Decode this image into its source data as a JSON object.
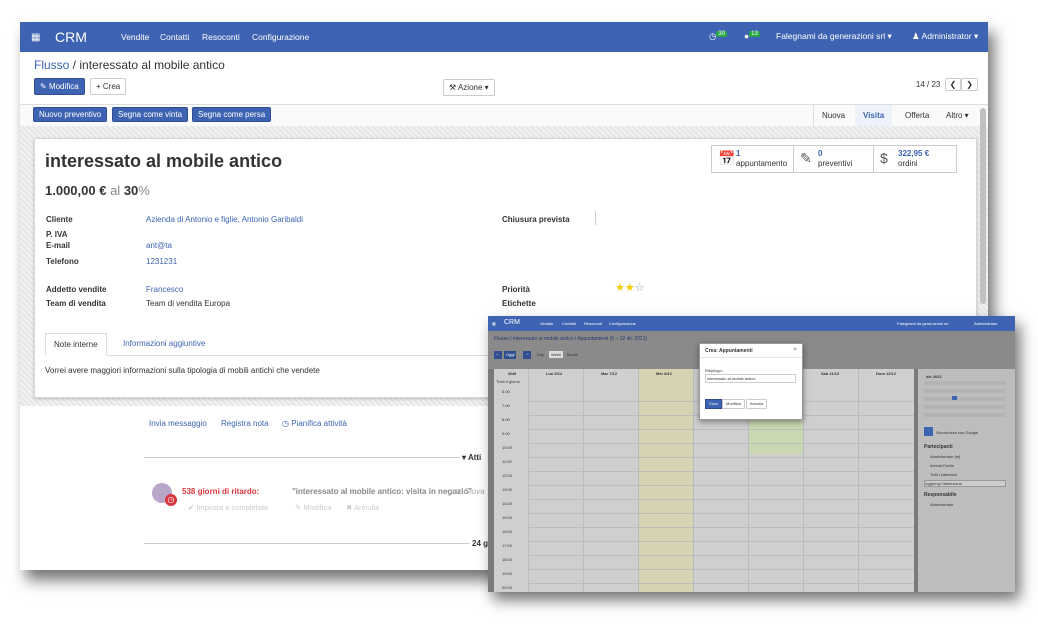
{
  "navbar": {
    "brand": "CRM",
    "menu": [
      "Vendite",
      "Contatti",
      "Resoconti",
      "Configurazione"
    ],
    "activity_count": "30",
    "message_count": "13",
    "company": "Falegnami da generazioni srl",
    "user": "Administrator"
  },
  "breadcrumb": {
    "parent": "Flusso",
    "current": "interessato al mobile antico"
  },
  "toolbar": {
    "edit": "Modifica",
    "create": "Crea",
    "action": "Azione",
    "pager": "14 / 23"
  },
  "statusbar": {
    "buttons": [
      "Nuovo preventivo",
      "Segna come vinta",
      "Segna come persa"
    ],
    "stages": [
      "Nuova",
      "Visita",
      "Offerta",
      "Altro"
    ],
    "active_stage": "Visita"
  },
  "smart_buttons": [
    {
      "icon": "calendar-icon",
      "count": "1",
      "label": "appuntamento"
    },
    {
      "icon": "edit-icon",
      "count": "0",
      "label": "preventivi"
    },
    {
      "icon": "dollar-icon",
      "count": "322,95 €",
      "label": "ordini"
    }
  ],
  "form": {
    "title": "interessato al mobile antico",
    "revenue": "1.000,00 €",
    "at": "al",
    "probability": "30",
    "percent": "%",
    "fields": {
      "cliente": {
        "label": "Cliente",
        "value": "Azienda di Antonio e figlie, Antonio Garibaldi"
      },
      "piva": {
        "label": "P. IVA",
        "value": ""
      },
      "email": {
        "label": "E-mail",
        "value": "ant@ta"
      },
      "telefono": {
        "label": "Telefono",
        "value": "1231231"
      },
      "addetto": {
        "label": "Addetto vendite",
        "value": "Francesco"
      },
      "team": {
        "label": "Team di vendita",
        "value": "Team di vendita Europa"
      },
      "chiusura": {
        "label": "Chiusura prevista",
        "value": ""
      },
      "priorita": {
        "label": "Priorità",
        "value": 2,
        "max": 3
      },
      "etichette": {
        "label": "Etichette",
        "value": ""
      }
    },
    "tabs": [
      "Note interne",
      "Informazioni aggiuntive"
    ],
    "note": "Vorrei avere maggiori informazioni sulla tipologia di mobili antichi che vendete"
  },
  "chatter": {
    "send_message": "Invia messaggio",
    "log_note": "Registra nota",
    "schedule": "Pianifica attività",
    "activities_header": "Atti",
    "overdue": "538 giorni di ritardo:",
    "activity_text": "\"interessato al mobile antico: visita in negozio\"",
    "per": "per Giova",
    "mark_done": "Imposta a completata",
    "edit": "Modifica",
    "cancel": "Annulla",
    "date_sep": "24 g"
  },
  "overlay": {
    "brand": "CRM",
    "menu": [
      "Vendite",
      "Contatti",
      "Resoconti",
      "Configurazione"
    ],
    "breadcrumb": "Flusso / interessato al mobile antico / Appuntamenti (6 – 12 dic 2021)",
    "today": "Oggi",
    "views": [
      "Day",
      "Week",
      "Month"
    ],
    "week_label": "W49",
    "days": [
      "Lun 6/12",
      "Mar 7/12",
      "Mer 8/12",
      "",
      "",
      "Sab 11/12",
      "Dom 12/12"
    ],
    "allday": "Tutto il giorno",
    "hours": [
      "6:00",
      "7:00",
      "8:00",
      "9:00",
      "10:00",
      "11:00",
      "12:00",
      "13:00",
      "14:00",
      "15:00",
      "16:00",
      "17:00",
      "18:00",
      "19:00",
      "20:00"
    ],
    "modal": {
      "title": "Crea: Appuntamenti",
      "summary_label": "Riepilogo:",
      "summary_value": "interessato al mobile antico",
      "create": "Crea",
      "edit": "Modifica",
      "cancel": "Annulla"
    },
    "sidebar": {
      "month": "dic 2021",
      "sync": "Sincronizza con Google",
      "participants": "Partecipanti",
      "p1": "Administrator [te]",
      "p2": "Arreda Facile",
      "all_calendars": "Tutti i calendari",
      "add": "Aggiungi l'attenzione",
      "responsible": "Responsabile",
      "r1": "Administrator"
    }
  }
}
